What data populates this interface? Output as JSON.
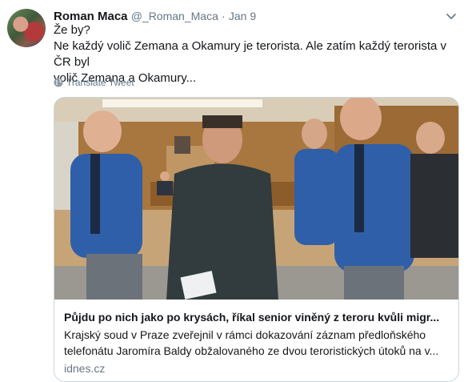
{
  "tweet": {
    "author_name": "Roman Maca",
    "handle": "@_Roman_Maca",
    "separator": "·",
    "date": "Jan 9",
    "text_lines": [
      "Že by?",
      "Ne každý volič Zemana a Okamury je terorista. Ale zatím každý terorista v ČR byl",
      "volič Zemana a Okamury..."
    ],
    "translate_label": "Translate Tweet"
  },
  "card": {
    "title": "Půjdu po nich jako po krysách, říkal senior viněný z teroru kvůli migr...",
    "description_lines": [
      "Krajský soud v Praze zveřejnil v rámci dokazování záznam předloňského",
      "telefonátu Jaromíra Baldy obžalovaného ze dvou teroristických útoků na v..."
    ],
    "domain": "idnes.cz"
  },
  "icons": {
    "menu": "chevron-down-icon",
    "translate": "globe-icon"
  },
  "colors": {
    "secondary_text": "#657786",
    "border": "#ccd6dd",
    "uniform_blue": "#2f5fa8"
  }
}
